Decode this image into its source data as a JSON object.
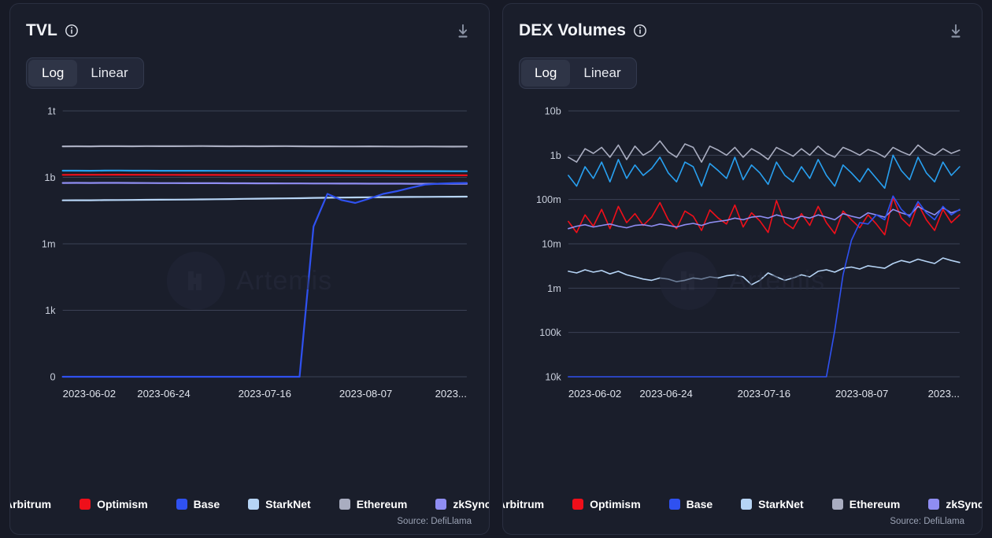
{
  "theme": {
    "page_bg": "#171a26",
    "card_bg": "#1a1e2b",
    "card_border": "#2a2f40",
    "grid": "#3a4054",
    "text": "#f2f4f8",
    "muted": "#9aa2b4"
  },
  "watermark": {
    "text": "Artemis",
    "logo_icon": "artemis-logo-icon"
  },
  "icons": {
    "info": "info-icon",
    "download": "download-icon"
  },
  "series_colors": {
    "Arbitrum": "#28a0f0",
    "Base": "#2f51f0",
    "Ethereum": "#a9adc0",
    "Optimism": "#ef0f1a",
    "StarkNet": "#b6d4f5",
    "zkSync Era": "#8f8df2"
  },
  "panels": [
    {
      "id": "tvl",
      "title": "TVL",
      "toggle": {
        "options": [
          "Log",
          "Linear"
        ],
        "selected": "Log"
      },
      "source": "Source: DefiLlama",
      "legend": [
        {
          "label": "Arbitrum",
          "color": "#28a0f0"
        },
        {
          "label": "Optimism",
          "color": "#ef0f1a"
        },
        {
          "label": "Base",
          "color": "#2f51f0"
        },
        {
          "label": "StarkNet",
          "color": "#b6d4f5"
        },
        {
          "label": "Ethereum",
          "color": "#a9adc0"
        },
        {
          "label": "zkSync Era",
          "color": "#8f8df2"
        }
      ],
      "chart_data": {
        "type": "line",
        "title": "TVL",
        "xlabel": "",
        "ylabel": "",
        "scale": "log",
        "grid": true,
        "legend_position": "bottom",
        "x_ticks": [
          "2023-06-02",
          "2023-06-24",
          "2023-07-16",
          "2023-08-07",
          "2023..."
        ],
        "y_ticks": [
          "1t",
          "1b",
          "1m",
          "1k",
          "0"
        ],
        "y_tick_values": [
          1000000000000,
          1000000000,
          1000000,
          1000,
          0
        ],
        "series": [
          {
            "name": "Ethereum",
            "color": "#a9adc0",
            "values": [
              25000000000,
              25200000000,
              25100000000,
              25600000000,
              25400000000,
              25300000000,
              25700000000,
              25500000000,
              25400000000,
              25600000000,
              25800000000,
              25500000000,
              25300000000,
              25400000000,
              25200000000,
              25400000000,
              25600000000,
              25300000000,
              25100000000,
              25000000000,
              24800000000,
              24900000000,
              25100000000,
              24900000000,
              24700000000,
              24600000000,
              24800000000,
              24700000000,
              24500000000,
              24600000000
            ]
          },
          {
            "name": "Arbitrum",
            "color": "#28a0f0",
            "values": [
              2000000000,
              2010000000,
              1990000000,
              2020000000,
              2030000000,
              2010000000,
              2000000000,
              1995000000,
              1985000000,
              1990000000,
              1980000000,
              1975000000,
              1970000000,
              1965000000,
              1960000000,
              1955000000,
              1960000000,
              1950000000,
              1945000000,
              1940000000,
              1935000000,
              1930000000,
              1925000000,
              1920000000,
              1915000000,
              1910000000,
              1905000000,
              1900000000,
              1895000000,
              1890000000
            ]
          },
          {
            "name": "Optimism",
            "color": "#ef0f1a",
            "values": [
              1300000000,
              1310000000,
              1305000000,
              1315000000,
              1320000000,
              1310000000,
              1305000000,
              1300000000,
              1295000000,
              1290000000,
              1288000000,
              1285000000,
              1282000000,
              1280000000,
              1278000000,
              1275000000,
              1272000000,
              1270000000,
              1268000000,
              1265000000,
              1262000000,
              1260000000,
              1258000000,
              1255000000,
              1252000000,
              1250000000,
              1248000000,
              1245000000,
              1242000000,
              1240000000
            ]
          },
          {
            "name": "zkSync Era",
            "color": "#8f8df2",
            "values": [
              560000000,
              565000000,
              558000000,
              562000000,
              566000000,
              560000000,
              555000000,
              552000000,
              550000000,
              548000000,
              546000000,
              544000000,
              542000000,
              540000000,
              538000000,
              536000000,
              534000000,
              532000000,
              530000000,
              528000000,
              526000000,
              524000000,
              522000000,
              520000000,
              518000000,
              516000000,
              515000000,
              514000000,
              513000000,
              512000000
            ]
          },
          {
            "name": "StarkNet",
            "color": "#b6d4f5",
            "values": [
              92000000,
              93000000,
              92500000,
              94000000,
              95000000,
              96000000,
              97000000,
              98000000,
              99000000,
              100000000,
              101000000,
              103000000,
              105000000,
              107000000,
              109000000,
              111000000,
              113000000,
              115000000,
              118000000,
              120000000,
              122000000,
              124000000,
              126000000,
              128000000,
              130000000,
              131000000,
              132000000,
              133000000,
              134000000,
              135000000
            ]
          },
          {
            "name": "Base",
            "color": "#2f51f0",
            "values": [
              0,
              0,
              0,
              0,
              0,
              0,
              0,
              0,
              0,
              0,
              0,
              0,
              0,
              0,
              0,
              0,
              0,
              0,
              6000000,
              180000000,
              95000000,
              70000000,
              110000000,
              180000000,
              240000000,
              340000000,
              470000000,
              520000000,
              545000000,
              560000000
            ]
          }
        ]
      }
    },
    {
      "id": "dex-volumes",
      "title": "DEX Volumes",
      "toggle": {
        "options": [
          "Log",
          "Linear"
        ],
        "selected": "Log"
      },
      "source": "Source: DefiLlama",
      "legend": [
        {
          "label": "Arbitrum",
          "color": "#28a0f0"
        },
        {
          "label": "Optimism",
          "color": "#ef0f1a"
        },
        {
          "label": "Base",
          "color": "#2f51f0"
        },
        {
          "label": "StarkNet",
          "color": "#b6d4f5"
        },
        {
          "label": "Ethereum",
          "color": "#a9adc0"
        },
        {
          "label": "zkSync Era",
          "color": "#8f8df2"
        }
      ],
      "chart_data": {
        "type": "line",
        "title": "DEX Volumes",
        "xlabel": "",
        "ylabel": "",
        "scale": "log",
        "grid": true,
        "legend_position": "bottom",
        "x_ticks": [
          "2023-06-02",
          "2023-06-24",
          "2023-07-16",
          "2023-08-07",
          "2023..."
        ],
        "y_ticks": [
          "10b",
          "1b",
          "100m",
          "10m",
          "1m",
          "100k",
          "10k"
        ],
        "y_tick_values": [
          10000000000,
          1000000000,
          100000000,
          10000000,
          1000000,
          100000,
          10000
        ],
        "series": [
          {
            "name": "Ethereum",
            "color": "#a9adc0",
            "values": [
              900000000,
              700000000,
              1400000000,
              1100000000,
              1500000000,
              900000000,
              1700000000,
              800000000,
              1600000000,
              1000000000,
              1300000000,
              2100000000,
              1200000000,
              900000000,
              1800000000,
              1500000000,
              700000000,
              1600000000,
              1300000000,
              1000000000,
              1500000000,
              900000000,
              1400000000,
              1100000000,
              800000000,
              1500000000,
              1200000000,
              950000000,
              1400000000,
              1000000000,
              1600000000,
              1100000000,
              900000000,
              1500000000,
              1250000000,
              1000000000,
              1350000000,
              1150000000,
              900000000,
              1500000000,
              1200000000,
              1000000000,
              1700000000,
              1200000000,
              1000000000,
              1400000000,
              1100000000,
              1300000000
            ]
          },
          {
            "name": "Arbitrum",
            "color": "#28a0f0",
            "values": [
              350000000,
              200000000,
              550000000,
              300000000,
              700000000,
              250000000,
              800000000,
              300000000,
              600000000,
              350000000,
              500000000,
              900000000,
              400000000,
              250000000,
              700000000,
              550000000,
              200000000,
              650000000,
              450000000,
              300000000,
              900000000,
              280000000,
              600000000,
              400000000,
              220000000,
              700000000,
              350000000,
              250000000,
              550000000,
              300000000,
              800000000,
              350000000,
              200000000,
              600000000,
              400000000,
              250000000,
              500000000,
              300000000,
              180000000,
              1000000000,
              450000000,
              280000000,
              900000000,
              400000000,
              250000000,
              700000000,
              350000000,
              550000000
            ]
          },
          {
            "name": "Optimism",
            "color": "#ef0f1a",
            "values": [
              32000000,
              18000000,
              45000000,
              25000000,
              60000000,
              22000000,
              70000000,
              30000000,
              48000000,
              26000000,
              40000000,
              85000000,
              35000000,
              22000000,
              55000000,
              42000000,
              20000000,
              58000000,
              38000000,
              28000000,
              75000000,
              24000000,
              50000000,
              33000000,
              18000000,
              95000000,
              30000000,
              22000000,
              48000000,
              26000000,
              70000000,
              30000000,
              17000000,
              55000000,
              35000000,
              23000000,
              45000000,
              28000000,
              16000000,
              110000000,
              38000000,
              25000000,
              80000000,
              35000000,
              20000000,
              60000000,
              30000000,
              45000000
            ]
          },
          {
            "name": "zkSync Era",
            "color": "#8f8df2",
            "values": [
              22000000,
              25000000,
              27000000,
              24000000,
              26000000,
              28000000,
              25000000,
              23000000,
              26000000,
              27000000,
              25000000,
              28000000,
              26000000,
              24000000,
              27000000,
              29000000,
              26000000,
              30000000,
              32000000,
              34000000,
              38000000,
              35000000,
              40000000,
              42000000,
              38000000,
              45000000,
              40000000,
              36000000,
              42000000,
              38000000,
              45000000,
              40000000,
              35000000,
              48000000,
              42000000,
              38000000,
              50000000,
              45000000,
              40000000,
              60000000,
              50000000,
              44000000,
              70000000,
              55000000,
              45000000,
              65000000,
              50000000,
              58000000
            ]
          },
          {
            "name": "StarkNet",
            "color": "#b6d4f5",
            "values": [
              2400000,
              2200000,
              2600000,
              2300000,
              2500000,
              2100000,
              2400000,
              2000000,
              1800000,
              1600000,
              1500000,
              1700000,
              1600000,
              1400000,
              1500000,
              1700000,
              1600000,
              1800000,
              1700000,
              1900000,
              2000000,
              1800000,
              1200000,
              1500000,
              2200000,
              1800000,
              1500000,
              1700000,
              2000000,
              1800000,
              2400000,
              2600000,
              2300000,
              2800000,
              3000000,
              2700000,
              3200000,
              3000000,
              2800000,
              3600000,
              4200000,
              3800000,
              4500000,
              4000000,
              3600000,
              4800000,
              4200000,
              3800000
            ]
          },
          {
            "name": "Base",
            "color": "#2f51f0",
            "values": [
              0,
              0,
              0,
              0,
              0,
              0,
              0,
              0,
              0,
              0,
              0,
              0,
              0,
              0,
              0,
              0,
              0,
              0,
              0,
              0,
              0,
              0,
              0,
              0,
              0,
              0,
              0,
              0,
              0,
              0,
              0,
              0,
              110000,
              2000000,
              12000000,
              30000000,
              28000000,
              45000000,
              35000000,
              120000000,
              60000000,
              40000000,
              90000000,
              50000000,
              35000000,
              70000000,
              45000000,
              60000000
            ]
          }
        ]
      }
    }
  ]
}
